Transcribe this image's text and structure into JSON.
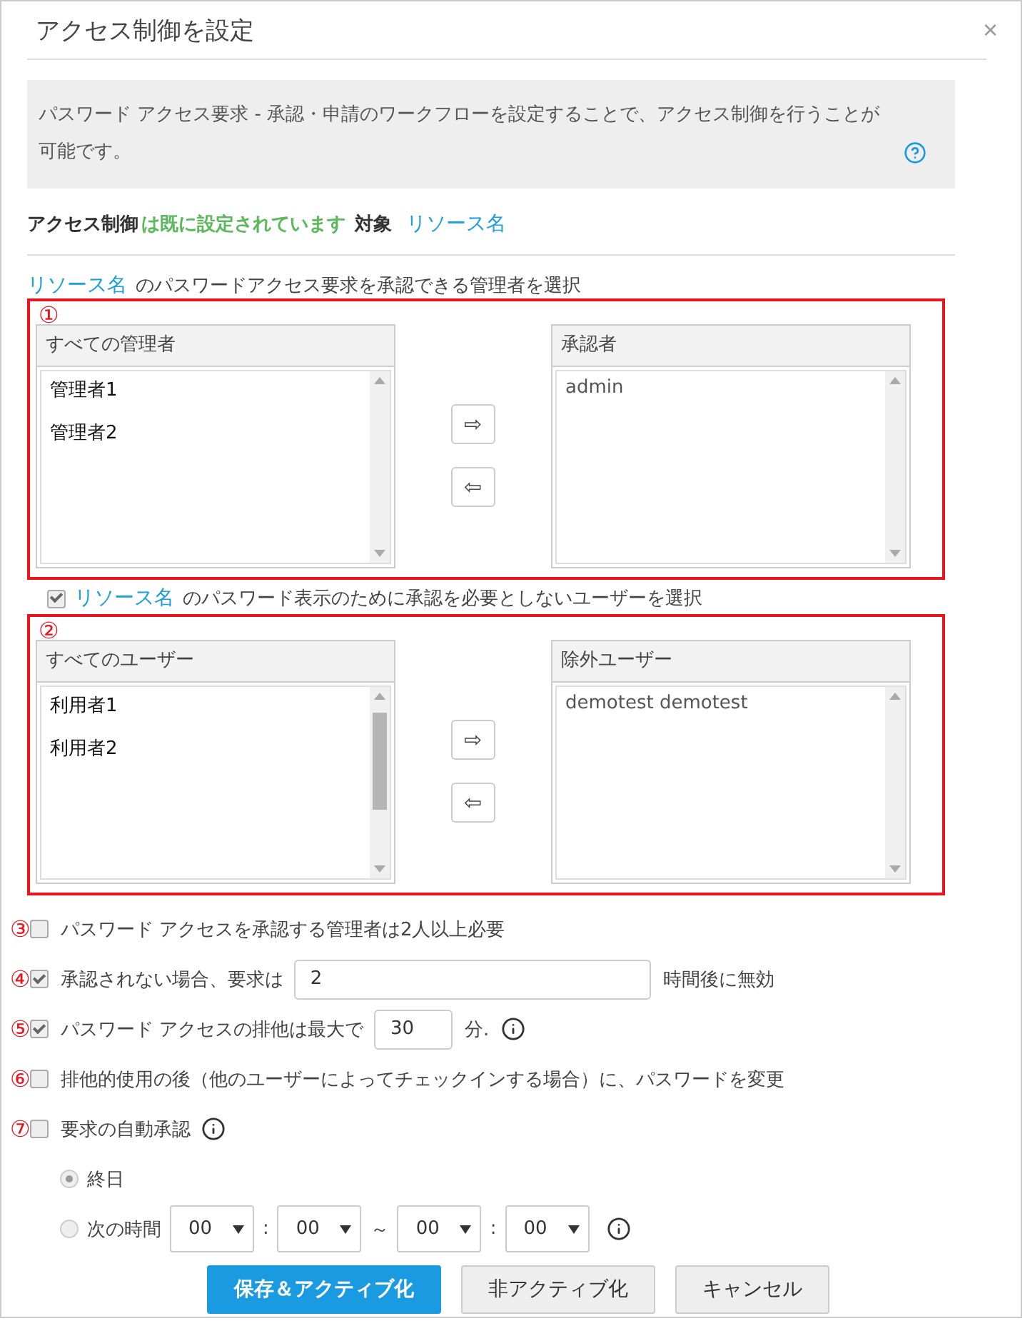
{
  "dialog": {
    "title": "アクセス制御を設定",
    "close": "×"
  },
  "info": {
    "text": "パスワード アクセス要求 - 承認・申請のワークフローを設定することで、アクセス制御を行うことが可能です。"
  },
  "status": {
    "subject": "アクセス制御",
    "message": "は既に設定されています",
    "target_label": "対象",
    "target_link": "リソース名"
  },
  "approver_section": {
    "link": "リソース名",
    "label": "のパスワードアクセス要求を承認できる管理者を選択",
    "marker": "①",
    "available": {
      "title": "すべての管理者",
      "items": [
        "管理者1",
        "管理者2"
      ]
    },
    "selected": {
      "title": "承認者",
      "items": [
        "admin"
      ]
    },
    "add": "⇨",
    "remove": "⇦"
  },
  "exclusion_section": {
    "checked": true,
    "link": "リソース名",
    "label": "のパスワード表示のために承認を必要としないユーザーを選択",
    "marker": "②",
    "available": {
      "title": "すべてのユーザー",
      "items": [
        "利用者1",
        "利用者2"
      ]
    },
    "selected": {
      "title": "除外ユーザー",
      "items": [
        "demotest demotest"
      ]
    },
    "add": "⇨",
    "remove": "⇦"
  },
  "options": [
    {
      "kind": "checkbox",
      "marker": "③",
      "checked": false,
      "label": "パスワード アクセスを承認する管理者は2人以上必要"
    },
    {
      "kind": "long_input",
      "marker": "④",
      "checked": true,
      "label": "承認されない場合、要求は",
      "value": "2",
      "suffix": "時間後に無効"
    },
    {
      "kind": "short_input",
      "marker": "⑤",
      "checked": true,
      "label": "パスワード アクセスの排他は最大で",
      "value": "30",
      "suffix": "分.",
      "info": true
    },
    {
      "kind": "checkbox",
      "marker": "⑥",
      "checked": false,
      "label": "排他的使用の後（他のユーザーによってチェックインする場合）に、パスワードを変更"
    },
    {
      "kind": "checkbox",
      "marker": "⑦",
      "checked": false,
      "label": "要求の自動承認",
      "info": true
    }
  ],
  "schedule": [
    {
      "label": "終日",
      "selected": true
    },
    {
      "label": "次の時間",
      "selected": false,
      "fields": [
        "00",
        "00",
        "00",
        "00"
      ],
      "separators": [
        ":",
        "～",
        ":"
      ],
      "info": true
    }
  ],
  "buttons": [
    {
      "label": "保存＆アクティブ化",
      "kind": "primary"
    },
    {
      "label": "非アクティブ化",
      "kind": "secondary"
    },
    {
      "label": "キャンセル",
      "kind": "secondary"
    }
  ]
}
